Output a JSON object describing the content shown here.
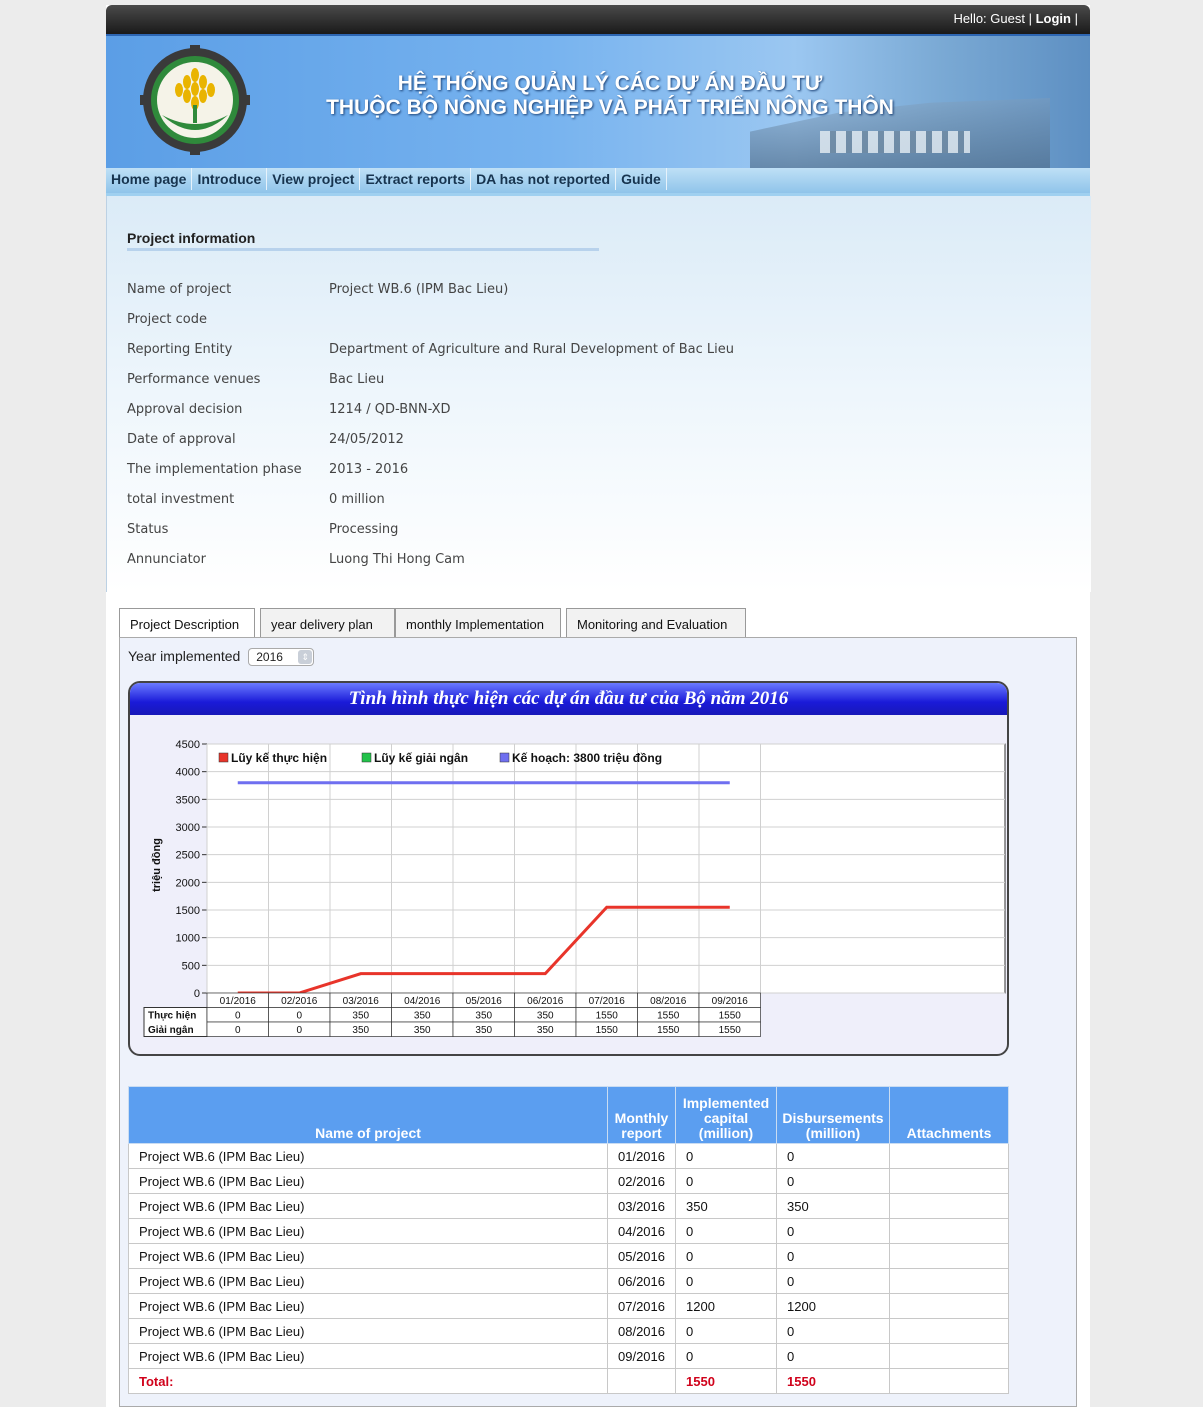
{
  "topbar": {
    "greeting": "Hello: Guest |",
    "login": "Login",
    "sep": "|"
  },
  "banner": {
    "title_line1": "HỆ THỐNG QUẢN LÝ CÁC DỰ ÁN ĐẦU TƯ",
    "title_line2": "THUỘC BỘ NÔNG NGHIỆP VÀ PHÁT TRIỂN NÔNG THÔN",
    "logo_icon": "ministry-logo-icon"
  },
  "nav": [
    "Home page",
    "Introduce",
    "View project",
    "Extract reports",
    "DA has not reported",
    "Guide"
  ],
  "info": {
    "heading": "Project information",
    "rows": [
      {
        "k": "Name of project",
        "v": "Project WB.6 (IPM Bac Lieu)"
      },
      {
        "k": "Project code",
        "v": ""
      },
      {
        "k": "Reporting Entity",
        "v": "Department of Agriculture and Rural Development of Bac Lieu"
      },
      {
        "k": "Performance venues",
        "v": "Bac Lieu"
      },
      {
        "k": "Approval decision",
        "v": "1214 / QD-BNN-XD"
      },
      {
        "k": "Date of approval",
        "v": "24/05/2012"
      },
      {
        "k": "The implementation phase",
        "v": "2013 - 2016"
      },
      {
        "k": "total investment",
        "v": "0 million"
      },
      {
        "k": "Status",
        "v": "Processing"
      },
      {
        "k": "Annunciator",
        "v": "Luong Thi Hong Cam"
      }
    ]
  },
  "tabs": [
    "Project Description",
    "year delivery plan",
    "monthly Implementation",
    "Monitoring and Evaluation"
  ],
  "year": {
    "label": "Year implemented",
    "value": "2016"
  },
  "chart_data": {
    "type": "line",
    "title": "Tình hình thực hiện các dự án đầu tư của Bộ năm 2016",
    "ylabel": "triệu đồng",
    "xlabel": "",
    "ylim": [
      0,
      4500
    ],
    "yticks": [
      0,
      500,
      1000,
      1500,
      2000,
      2500,
      3000,
      3500,
      4000,
      4500
    ],
    "categories": [
      "01/2016",
      "02/2016",
      "03/2016",
      "04/2016",
      "05/2016",
      "06/2016",
      "07/2016",
      "08/2016",
      "09/2016"
    ],
    "series": [
      {
        "name": "Lũy kế thực hiện",
        "color": "#e8342a",
        "values": [
          0,
          0,
          350,
          350,
          350,
          350,
          1550,
          1550,
          1550
        ]
      },
      {
        "name": "Lũy kế giải ngân",
        "color": "#22c24a",
        "values": []
      },
      {
        "name": "Kế hoạch: 3800 triệu đồng",
        "color": "#6f6ff0",
        "values": [
          3800,
          3800,
          3800,
          3800,
          3800,
          3800,
          3800,
          3800,
          3800
        ]
      }
    ],
    "legend": "top-left",
    "grid": true,
    "table_rows": [
      {
        "label": "Thực hiện",
        "values": [
          "0",
          "0",
          "350",
          "350",
          "350",
          "350",
          "1550",
          "1550",
          "1550"
        ]
      },
      {
        "label": "Giải ngân",
        "values": [
          "0",
          "0",
          "350",
          "350",
          "350",
          "350",
          "1550",
          "1550",
          "1550"
        ]
      }
    ]
  },
  "table": {
    "headers": [
      "Name of project",
      "Monthly report",
      "Implemented capital (million)",
      "Disbursements (million)",
      "Attachments"
    ],
    "rows": [
      [
        "Project WB.6 (IPM Bac Lieu)",
        "01/2016",
        "0",
        "0",
        ""
      ],
      [
        "Project WB.6 (IPM Bac Lieu)",
        "02/2016",
        "0",
        "0",
        ""
      ],
      [
        "Project WB.6 (IPM Bac Lieu)",
        "03/2016",
        "350",
        "350",
        ""
      ],
      [
        "Project WB.6 (IPM Bac Lieu)",
        "04/2016",
        "0",
        "0",
        ""
      ],
      [
        "Project WB.6 (IPM Bac Lieu)",
        "05/2016",
        "0",
        "0",
        ""
      ],
      [
        "Project WB.6 (IPM Bac Lieu)",
        "06/2016",
        "0",
        "0",
        ""
      ],
      [
        "Project WB.6 (IPM Bac Lieu)",
        "07/2016",
        "1200",
        "1200",
        ""
      ],
      [
        "Project WB.6 (IPM Bac Lieu)",
        "08/2016",
        "0",
        "0",
        ""
      ],
      [
        "Project WB.6 (IPM Bac Lieu)",
        "09/2016",
        "0",
        "0",
        ""
      ]
    ],
    "total": {
      "label": "Total:",
      "capital": "1550",
      "disbursement": "1550"
    }
  }
}
